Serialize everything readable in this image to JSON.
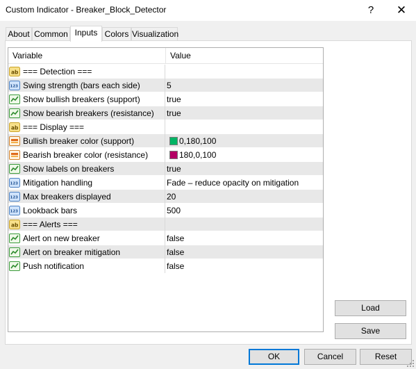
{
  "window": {
    "title": "Custom Indicator - Breaker_Block_Detector",
    "help_glyph": "?",
    "close_glyph": "✕"
  },
  "tabs": [
    {
      "label": "About"
    },
    {
      "label": "Common"
    },
    {
      "label": "Inputs",
      "active": true
    },
    {
      "label": "Colors"
    },
    {
      "label": "Visualization"
    }
  ],
  "grid": {
    "col_variable": "Variable",
    "col_value": "Value",
    "rows": [
      {
        "icon": "ab-string-icon",
        "name": "=== Detection ===",
        "value": ""
      },
      {
        "icon": "123-int-icon",
        "name": "Swing strength (bars each side)",
        "value": "5"
      },
      {
        "icon": "bool-toggle-icon",
        "name": "Show bullish breakers (support)",
        "value": "true"
      },
      {
        "icon": "bool-toggle-icon",
        "name": "Show bearish breakers (resistance)",
        "value": "true"
      },
      {
        "icon": "ab-string-icon",
        "name": "=== Display ===",
        "value": ""
      },
      {
        "icon": "color-palette-icon",
        "name": "Bullish breaker color (support)",
        "value": "0,180,100",
        "swatch": "#00b464"
      },
      {
        "icon": "color-palette-icon",
        "name": "Bearish breaker color (resistance)",
        "value": "180,0,100",
        "swatch": "#b40064"
      },
      {
        "icon": "bool-toggle-icon",
        "name": "Show labels on breakers",
        "value": "true"
      },
      {
        "icon": "123-int-icon",
        "name": "Mitigation handling",
        "value": "Fade – reduce opacity on mitigation"
      },
      {
        "icon": "123-int-icon",
        "name": "Max breakers displayed",
        "value": "20"
      },
      {
        "icon": "123-int-icon",
        "name": "Lookback bars",
        "value": "500"
      },
      {
        "icon": "ab-string-icon",
        "name": "=== Alerts ===",
        "value": ""
      },
      {
        "icon": "bool-toggle-icon",
        "name": "Alert on new breaker",
        "value": "false"
      },
      {
        "icon": "bool-toggle-icon",
        "name": "Alert on breaker mitigation",
        "value": "false"
      },
      {
        "icon": "bool-toggle-icon",
        "name": "Push notification",
        "value": "false"
      }
    ]
  },
  "side_buttons": {
    "load": "Load",
    "save": "Save"
  },
  "footer_buttons": {
    "ok": "OK",
    "cancel": "Cancel",
    "reset": "Reset"
  },
  "colors": {
    "accent": "#0078d7",
    "row_alt": "#e8e8e8"
  }
}
